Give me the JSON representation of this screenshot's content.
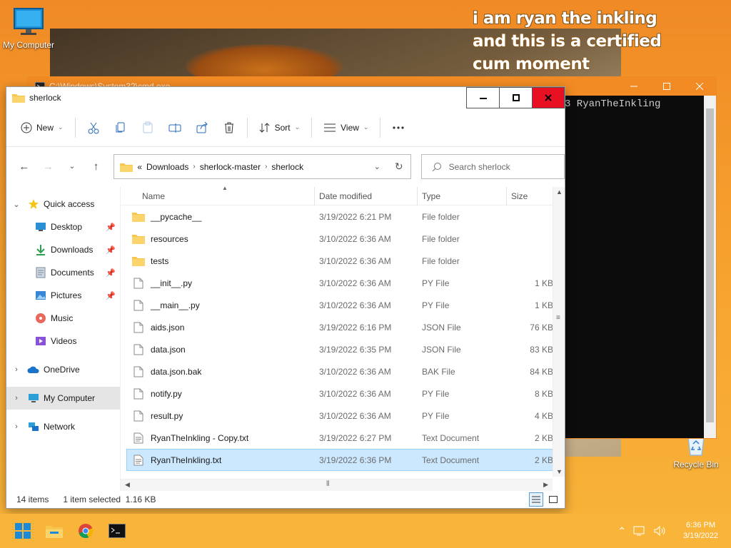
{
  "desktop": {
    "meme_text": "i am ryan the inkling and this is a certified cum moment",
    "icons": [
      {
        "label": "My Computer",
        "icon": "monitor-icon"
      },
      {
        "label": "Recycle Bin",
        "icon": "recycle-bin-icon"
      }
    ]
  },
  "cmd": {
    "title": "C:\\Windows\\System32\\cmd.exe",
    "text": "3 RyanTheInkling",
    "background": "#0c0c0c",
    "titlebar_color": "#f28b24"
  },
  "explorer": {
    "title": "sherlock",
    "toolbar": {
      "new_label": "New",
      "sort_label": "Sort",
      "view_label": "View",
      "icons": [
        "cut-icon",
        "copy-icon",
        "paste-icon",
        "rename-icon",
        "share-icon",
        "delete-icon",
        "more-icon"
      ]
    },
    "address": {
      "overflow": "«",
      "crumbs": [
        "Downloads",
        "sherlock-master",
        "sherlock"
      ]
    },
    "search": {
      "placeholder": "Search sherlock"
    },
    "nav": {
      "quick_access": "Quick access",
      "items": [
        {
          "label": "Desktop",
          "icon": "desktop-icon",
          "pinned": true
        },
        {
          "label": "Downloads",
          "icon": "download-icon",
          "pinned": true
        },
        {
          "label": "Documents",
          "icon": "documents-icon",
          "pinned": true
        },
        {
          "label": "Pictures",
          "icon": "pictures-icon",
          "pinned": true
        },
        {
          "label": "Music",
          "icon": "music-icon",
          "pinned": false
        },
        {
          "label": "Videos",
          "icon": "videos-icon",
          "pinned": false
        }
      ],
      "onedrive": "OneDrive",
      "my_computer": "My Computer",
      "network": "Network"
    },
    "columns": {
      "name": "Name",
      "date": "Date modified",
      "type": "Type",
      "size": "Size"
    },
    "files": [
      {
        "name": "__pycache__",
        "date": "3/19/2022 6:21 PM",
        "type": "File folder",
        "size": "",
        "kind": "folder"
      },
      {
        "name": "resources",
        "date": "3/10/2022 6:36 AM",
        "type": "File folder",
        "size": "",
        "kind": "folder"
      },
      {
        "name": "tests",
        "date": "3/10/2022 6:36 AM",
        "type": "File folder",
        "size": "",
        "kind": "folder"
      },
      {
        "name": "__init__.py",
        "date": "3/10/2022 6:36 AM",
        "type": "PY File",
        "size": "1 KB",
        "kind": "file"
      },
      {
        "name": "__main__.py",
        "date": "3/10/2022 6:36 AM",
        "type": "PY File",
        "size": "1 KB",
        "kind": "file"
      },
      {
        "name": "aids.json",
        "date": "3/19/2022 6:16 PM",
        "type": "JSON File",
        "size": "76 KB",
        "kind": "file"
      },
      {
        "name": "data.json",
        "date": "3/19/2022 6:35 PM",
        "type": "JSON File",
        "size": "83 KB",
        "kind": "file"
      },
      {
        "name": "data.json.bak",
        "date": "3/10/2022 6:36 AM",
        "type": "BAK File",
        "size": "84 KB",
        "kind": "file"
      },
      {
        "name": "notify.py",
        "date": "3/10/2022 6:36 AM",
        "type": "PY File",
        "size": "8 KB",
        "kind": "file"
      },
      {
        "name": "result.py",
        "date": "3/10/2022 6:36 AM",
        "type": "PY File",
        "size": "4 KB",
        "kind": "file"
      },
      {
        "name": "RyanTheInkling - Copy.txt",
        "date": "3/19/2022 6:27 PM",
        "type": "Text Document",
        "size": "2 KB",
        "kind": "text"
      },
      {
        "name": "RyanTheInkling.txt",
        "date": "3/19/2022 6:36 PM",
        "type": "Text Document",
        "size": "2 KB",
        "kind": "text",
        "selected": true
      }
    ],
    "status": {
      "items": "14 items",
      "selected": "1 item selected",
      "size": "1.16 KB"
    }
  },
  "taskbar": {
    "apps": [
      "windows-start-icon",
      "file-explorer-icon",
      "chrome-icon",
      "cmd-icon"
    ],
    "time": "6:36 PM",
    "date": "3/19/2022",
    "background": "#f9b43a"
  }
}
